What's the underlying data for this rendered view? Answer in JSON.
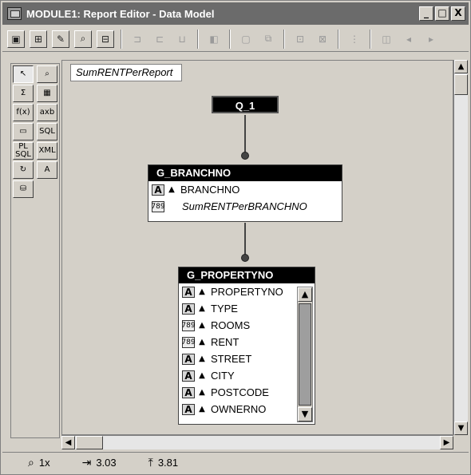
{
  "window": {
    "title": "MODULE1: Report Editor - Data Model",
    "minimize": "_",
    "maximize": "□",
    "close": "X"
  },
  "toolbar": {
    "buttons": [
      "open-icon",
      "new-query-icon",
      "edit-icon",
      "preview-icon",
      "data-model-icon",
      "layout-icon",
      "layout2-icon",
      "layout3-icon",
      "compile-icon",
      "param-icon",
      "param2-icon",
      "run-icon",
      "run2-icon",
      "grid-icon",
      "first-page-icon",
      "prev-page-icon",
      "next-page-icon"
    ]
  },
  "palette": {
    "tools": [
      {
        "name": "select-tool",
        "glyph": "↖"
      },
      {
        "name": "magnify-tool",
        "glyph": "🔍"
      },
      {
        "name": "summary-tool",
        "glyph": "Σ"
      },
      {
        "name": "table-tool",
        "glyph": "▦"
      },
      {
        "name": "formula-tool",
        "glyph": "f(x)"
      },
      {
        "name": "cross-product-tool",
        "glyph": "axb"
      },
      {
        "name": "placeholder-tool",
        "glyph": "▭"
      },
      {
        "name": "sql-query-tool",
        "glyph": "SQL"
      },
      {
        "name": "plsql-tool",
        "glyph": "PL SQL"
      },
      {
        "name": "xml-tool",
        "glyph": "XML"
      },
      {
        "name": "link-tool",
        "glyph": "↻"
      },
      {
        "name": "text-tool",
        "glyph": "A"
      },
      {
        "name": "database-tool",
        "glyph": "⛁"
      }
    ]
  },
  "model": {
    "summary_name": "SumRENTPerReport",
    "query_name": "Q_1",
    "group1": {
      "title": "G_BRANCHNO",
      "columns": [
        {
          "type": "A",
          "name": "BRANCHNO",
          "style": "normal"
        },
        {
          "type": "789",
          "name": "SumRENTPerBRANCHNO",
          "style": "italic"
        }
      ]
    },
    "group2": {
      "title": "G_PROPERTYNO",
      "columns": [
        {
          "type": "A",
          "name": "PROPERTYNO"
        },
        {
          "type": "A",
          "name": "TYPE"
        },
        {
          "type": "789",
          "name": "ROOMS"
        },
        {
          "type": "789",
          "name": "RENT"
        },
        {
          "type": "A",
          "name": "STREET"
        },
        {
          "type": "A",
          "name": "CITY"
        },
        {
          "type": "A",
          "name": "POSTCODE"
        },
        {
          "type": "A",
          "name": "OWNERNO"
        }
      ]
    }
  },
  "status": {
    "zoom": "1x",
    "x_pos": "3.03",
    "y_pos": "3.81"
  }
}
